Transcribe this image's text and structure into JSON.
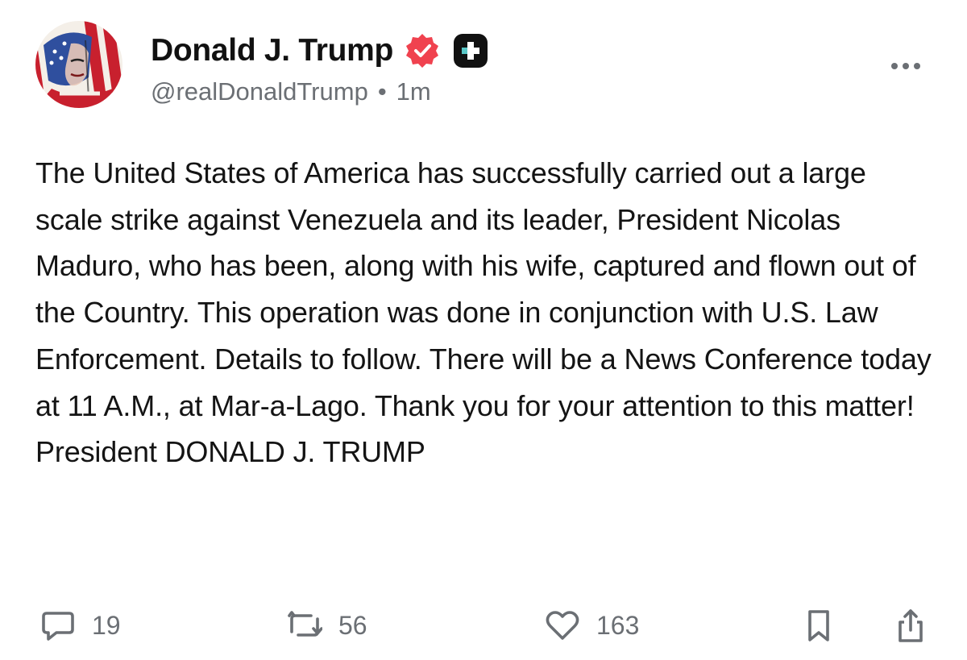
{
  "author": {
    "display_name": "Donald J. Trump",
    "handle": "@realDonaldTrump",
    "separator": "•",
    "time_ago": "1m",
    "verified_icon": "verified-badge-icon",
    "verified_color": "#f0424f",
    "plus_badge_icon": "plus-badge-icon"
  },
  "post": {
    "text": "The United States of America has successfully carried out a large scale strike against Venezuela and its leader, President Nicolas Maduro, who has been, along with his wife, captured and flown out of the Country. This operation was done in conjunction with U.S. Law Enforcement. Details to follow. There will be a News Conference today at 11 A.M., at Mar-a-Lago. Thank you for your attention to this matter! President DONALD J. TRUMP"
  },
  "actions": {
    "reply": {
      "icon": "reply-icon",
      "count": "19"
    },
    "retruth": {
      "icon": "retruth-icon",
      "count": "56"
    },
    "like": {
      "icon": "heart-icon",
      "count": "163"
    },
    "bookmark": {
      "icon": "bookmark-icon"
    },
    "share": {
      "icon": "share-icon"
    }
  },
  "menu": {
    "icon": "more-options-icon"
  },
  "colors": {
    "text": "#141414",
    "muted": "#6b6f74",
    "background": "#ffffff"
  }
}
